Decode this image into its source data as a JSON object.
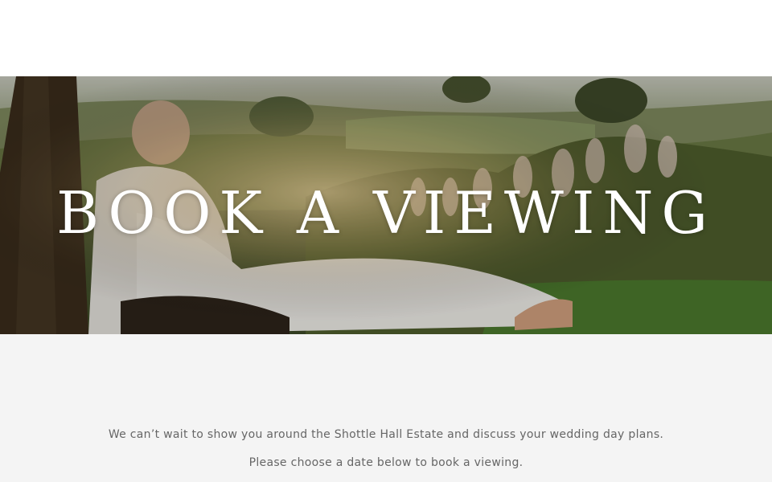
{
  "hero": {
    "title": "BOOK A VIEWING",
    "image_icon": "photo-image"
  },
  "content": {
    "line1": "We can’t wait to show you around the Shottle Hall Estate and discuss your wedding day plans.",
    "line2": "Please choose a date below to book a viewing."
  },
  "colors": {
    "header_bg": "#ffffff",
    "content_bg": "#f4f4f4",
    "title_text": "#ffffff",
    "body_text": "#666666"
  }
}
